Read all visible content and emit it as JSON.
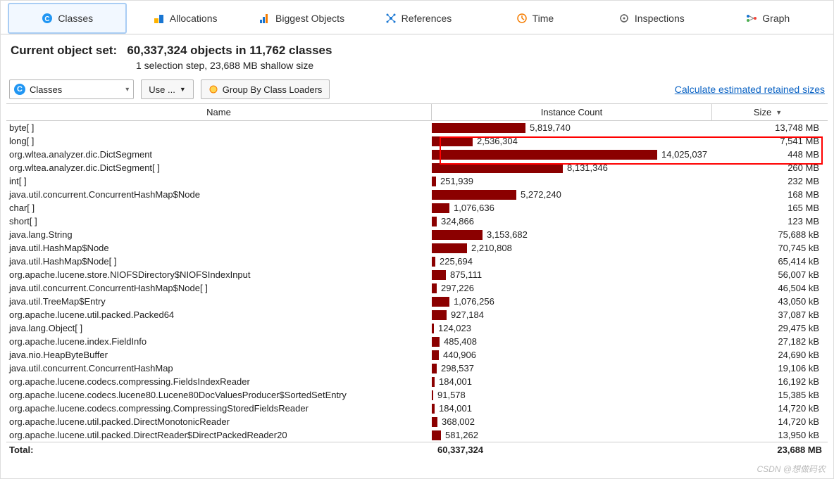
{
  "tabs": {
    "classes": "Classes",
    "allocations": "Allocations",
    "biggest": "Biggest Objects",
    "references": "References",
    "time": "Time",
    "inspections": "Inspections",
    "graph": "Graph"
  },
  "summary": {
    "prefix": "Current object set:",
    "main": "60,337,324 objects in 11,762 classes",
    "sub": "1 selection step, 23,688 MB shallow size"
  },
  "toolbar": {
    "combo_label": "Classes",
    "use_label": "Use ...",
    "group_label": "Group By Class Loaders",
    "link": "Calculate estimated retained sizes"
  },
  "columns": {
    "name": "Name",
    "count": "Instance Count",
    "size": "Size"
  },
  "max_count": 14025037,
  "rows": [
    {
      "name": "byte[ ]",
      "count": 5819740,
      "count_s": "5,819,740",
      "size": "13,748 MB"
    },
    {
      "name": "long[ ]",
      "count": 2536304,
      "count_s": "2,536,304",
      "size": "7,541 MB"
    },
    {
      "name": "org.wltea.analyzer.dic.DictSegment",
      "count": 14025037,
      "count_s": "14,025,037",
      "size": "448 MB"
    },
    {
      "name": "org.wltea.analyzer.dic.DictSegment[ ]",
      "count": 8131346,
      "count_s": "8,131,346",
      "size": "260 MB"
    },
    {
      "name": "int[ ]",
      "count": 251939,
      "count_s": "251,939",
      "size": "232 MB"
    },
    {
      "name": "java.util.concurrent.ConcurrentHashMap$Node",
      "count": 5272240,
      "count_s": "5,272,240",
      "size": "168 MB"
    },
    {
      "name": "char[ ]",
      "count": 1076636,
      "count_s": "1,076,636",
      "size": "165 MB"
    },
    {
      "name": "short[ ]",
      "count": 324866,
      "count_s": "324,866",
      "size": "123 MB"
    },
    {
      "name": "java.lang.String",
      "count": 3153682,
      "count_s": "3,153,682",
      "size": "75,688 kB"
    },
    {
      "name": "java.util.HashMap$Node",
      "count": 2210808,
      "count_s": "2,210,808",
      "size": "70,745 kB"
    },
    {
      "name": "java.util.HashMap$Node[ ]",
      "count": 225694,
      "count_s": "225,694",
      "size": "65,414 kB"
    },
    {
      "name": "org.apache.lucene.store.NIOFSDirectory$NIOFSIndexInput",
      "count": 875111,
      "count_s": "875,111",
      "size": "56,007 kB"
    },
    {
      "name": "java.util.concurrent.ConcurrentHashMap$Node[ ]",
      "count": 297226,
      "count_s": "297,226",
      "size": "46,504 kB"
    },
    {
      "name": "java.util.TreeMap$Entry",
      "count": 1076256,
      "count_s": "1,076,256",
      "size": "43,050 kB"
    },
    {
      "name": "org.apache.lucene.util.packed.Packed64",
      "count": 927184,
      "count_s": "927,184",
      "size": "37,087 kB"
    },
    {
      "name": "java.lang.Object[ ]",
      "count": 124023,
      "count_s": "124,023",
      "size": "29,475 kB"
    },
    {
      "name": "org.apache.lucene.index.FieldInfo",
      "count": 485408,
      "count_s": "485,408",
      "size": "27,182 kB"
    },
    {
      "name": "java.nio.HeapByteBuffer",
      "count": 440906,
      "count_s": "440,906",
      "size": "24,690 kB"
    },
    {
      "name": "java.util.concurrent.ConcurrentHashMap",
      "count": 298537,
      "count_s": "298,537",
      "size": "19,106 kB"
    },
    {
      "name": "org.apache.lucene.codecs.compressing.FieldsIndexReader",
      "count": 184001,
      "count_s": "184,001",
      "size": "16,192 kB"
    },
    {
      "name": "org.apache.lucene.codecs.lucene80.Lucene80DocValuesProducer$SortedSetEntry",
      "count": 91578,
      "count_s": "91,578",
      "size": "15,385 kB"
    },
    {
      "name": "org.apache.lucene.codecs.compressing.CompressingStoredFieldsReader",
      "count": 184001,
      "count_s": "184,001",
      "size": "14,720 kB"
    },
    {
      "name": "org.apache.lucene.util.packed.DirectMonotonicReader",
      "count": 368002,
      "count_s": "368,002",
      "size": "14,720 kB"
    },
    {
      "name": "org.apache.lucene.util.packed.DirectReader$DirectPackedReader20",
      "count": 581262,
      "count_s": "581,262",
      "size": "13,950 kB"
    }
  ],
  "total": {
    "label": "Total:",
    "count": "60,337,324",
    "size": "23,688 MB"
  },
  "watermark": "CSDN @想做码农"
}
